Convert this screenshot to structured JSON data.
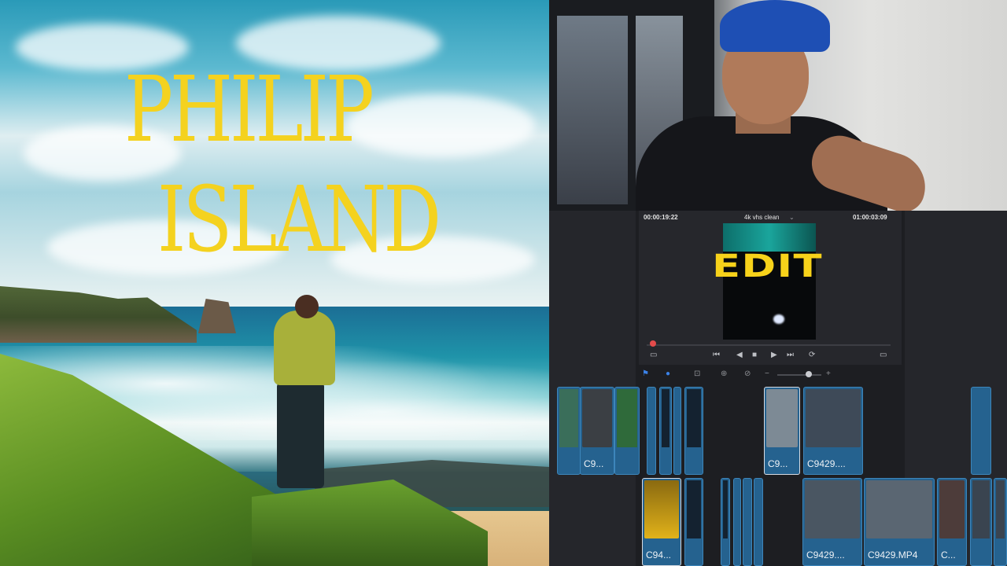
{
  "photo_title": {
    "line1": "PHILIP",
    "line2": "ISLAND"
  },
  "viewer": {
    "timecode_left": "00:00:19:22",
    "clip_name": "4k vhs clean",
    "timecode_right": "01:00:03:09",
    "overlay_word": "EDIT"
  },
  "transport": {
    "prev_icon": "⏮",
    "back_icon": "◀",
    "stop_icon": "■",
    "play_icon": "▶",
    "next_icon": "⏭",
    "loop_icon": "⟳"
  },
  "timeline": {
    "track1_labels": [
      "C9...",
      "C9...",
      "C9429...."
    ],
    "track2_labels": [
      "C94...",
      "C9429....",
      "C9429.MP4",
      "C..."
    ]
  },
  "colors": {
    "accent_yellow": "#f4d21f",
    "clip_blue": "#25628f"
  }
}
